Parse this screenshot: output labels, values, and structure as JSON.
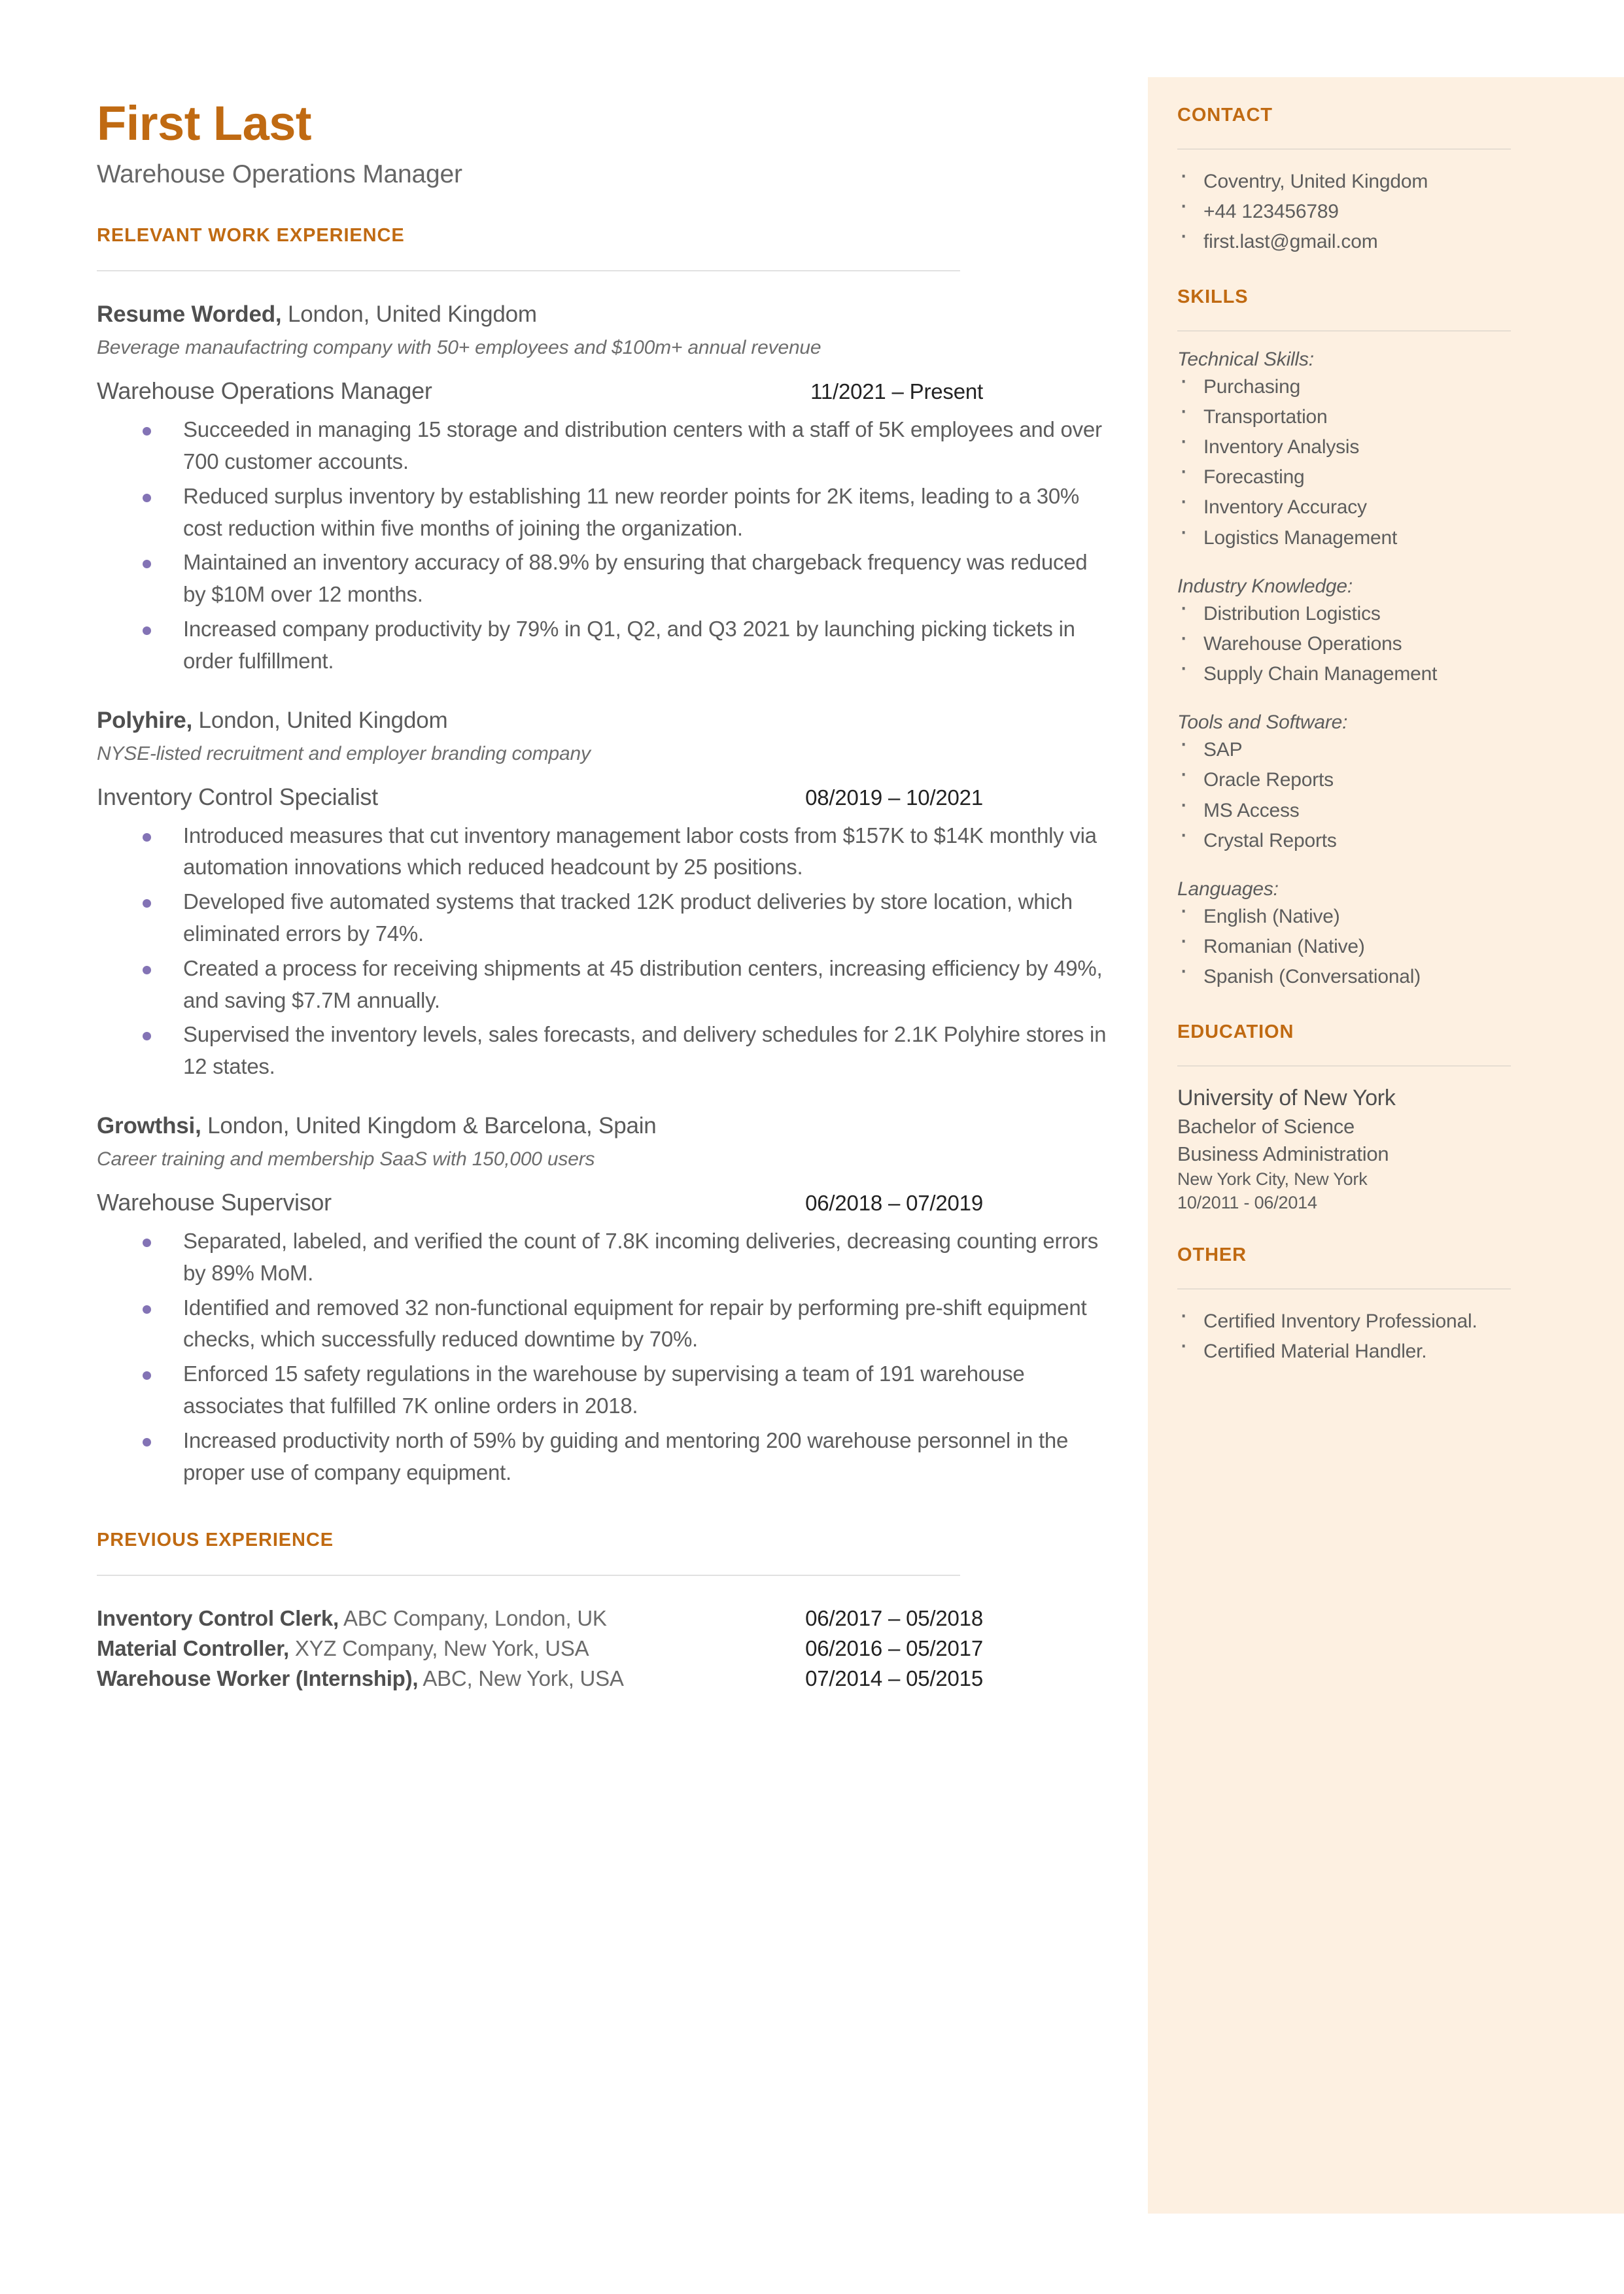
{
  "header": {
    "name": "First Last",
    "title": "Warehouse Operations  Manager"
  },
  "sections": {
    "relevant_experience_heading": "RELEVANT WORK EXPERIENCE",
    "previous_experience_heading": "PREVIOUS EXPERIENCE"
  },
  "jobs": [
    {
      "company": "Resume Worded,",
      "location": " London, United Kingdom",
      "description": "Beverage manaufactring company  with 50+ employees and $100m+ annual revenue",
      "title": "Warehouse Operations  Manager",
      "dates": "11/2021 – Present",
      "bullets": [
        "Succeeded in managing 15 storage and distribution centers with a staff of 5K employees and over 700 customer accounts.",
        "Reduced surplus inventory by establishing 11 new reorder points for 2K items, leading to a 30% cost reduction within five months of joining the organization.",
        "Maintained an inventory accuracy of 88.9% by ensuring that chargeback frequency was reduced by $10M over 12 months.",
        "Increased company productivity by 79% in Q1, Q2, and Q3 2021 by launching picking tickets in order fulfillment."
      ]
    },
    {
      "company": "Polyhire,",
      "location": " London, United Kingdom",
      "description": "NYSE-listed recruitment and employer branding company",
      "title": "Inventory Control Specialist",
      "dates": "08/2019 – 10/2021",
      "bullets": [
        "Introduced measures that cut inventory management labor costs from $157K to $14K monthly via automation innovations which reduced headcount by 25 positions.",
        "Developed five automated systems that tracked 12K product deliveries by store location, which eliminated errors by 74%.",
        "Created a process for receiving shipments at 45 distribution centers, increasing efficiency by 49%, and saving $7.7M annually.",
        "Supervised the inventory levels, sales forecasts, and delivery schedules for 2.1K Polyhire stores in 12 states."
      ]
    },
    {
      "company": "Growthsi,",
      "location": " London, United Kingdom & Barcelona, Spain",
      "description": "Career training and membership SaaS with 150,000 users",
      "title": "Warehouse Supervisor",
      "dates": "06/2018 – 07/2019",
      "bullets": [
        "Separated, labeled, and verified the count of 7.8K incoming deliveries, decreasing counting errors by 89% MoM.",
        "Identified and removed 32 non-functional equipment for repair by performing pre-shift equipment checks, which successfully reduced downtime by 70%.",
        "Enforced 15 safety regulations in the warehouse by supervising a team of 191 warehouse associates that fulfilled 7K online orders in 2018.",
        "Increased productivity north of 59% by guiding and mentoring 200 warehouse personnel in the proper use of company equipment."
      ]
    }
  ],
  "previous_experience": [
    {
      "title": "Inventory Control Clerk,",
      "detail": " ABC Company, London, UK",
      "dates": "06/2017 – 05/2018"
    },
    {
      "title": "Material Controller,",
      "detail": " XYZ Company, New York, USA",
      "dates": "06/2016 – 05/2017"
    },
    {
      "title": "Warehouse Worker (Internship),",
      "detail": " ABC, New York, USA",
      "dates": "07/2014 – 05/2015"
    }
  ],
  "sidebar": {
    "contact": {
      "heading": "CONTACT",
      "items": [
        "Coventry, United Kingdom",
        "+44 123456789",
        "first.last@gmail.com"
      ]
    },
    "skills": {
      "heading": "SKILLS",
      "groups": [
        {
          "label": "Technical Skills:",
          "items": [
            "Purchasing",
            "Transportation",
            "Inventory Analysis",
            "Forecasting",
            "Inventory Accuracy",
            "Logistics Management"
          ]
        },
        {
          "label": "Industry Knowledge:",
          "items": [
            "Distribution Logistics",
            "Warehouse Operations",
            "Supply Chain Management"
          ]
        },
        {
          "label": "Tools and Software:",
          "items": [
            "SAP",
            "Oracle Reports",
            "MS Access",
            "Crystal Reports"
          ]
        },
        {
          "label": "Languages:",
          "items": [
            "English (Native)",
            "Romanian (Native)",
            "Spanish (Conversational)"
          ]
        }
      ]
    },
    "education": {
      "heading": "EDUCATION",
      "school": "University of New York",
      "degree": "Bachelor of Science",
      "field": "Business Administration",
      "location": "New York City, New York",
      "dates": "10/2011 - 06/2014"
    },
    "other": {
      "heading": "OTHER",
      "items": [
        "Certified Inventory Professional.",
        "Certified Material Handler."
      ]
    }
  },
  "colors": {
    "accent": "#c06a12",
    "sidebar_bg": "#fdf0e1",
    "bullet": "#8373b5",
    "body_text": "#5d5d5d"
  }
}
